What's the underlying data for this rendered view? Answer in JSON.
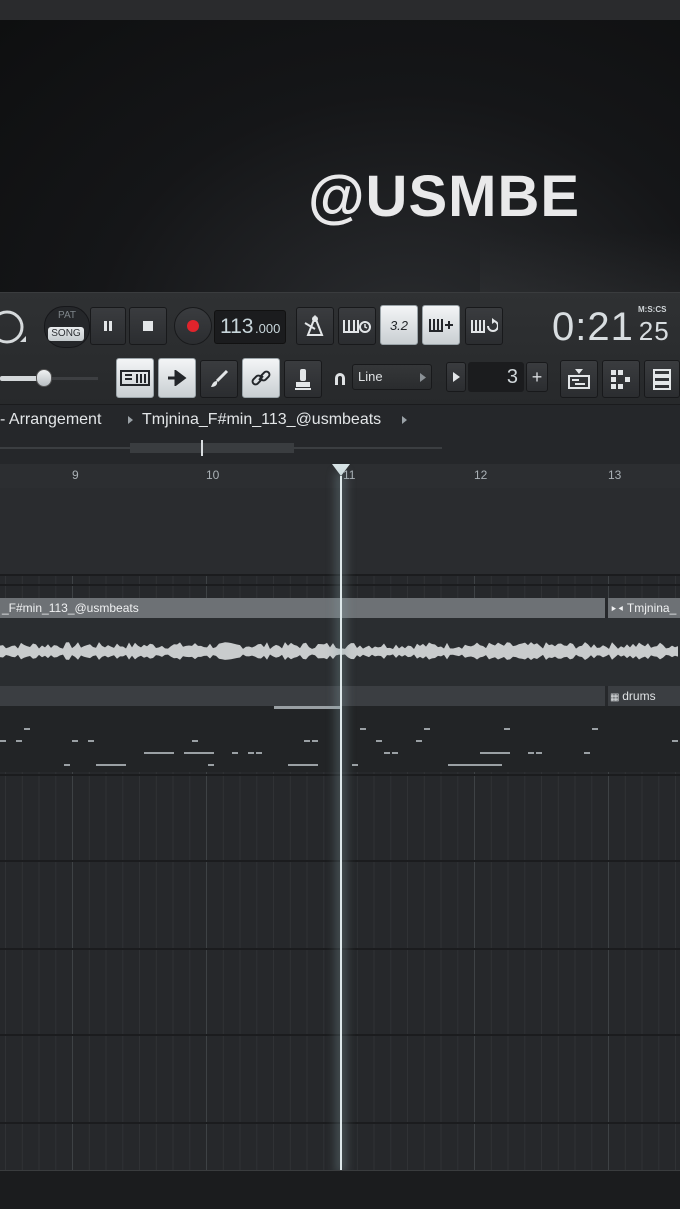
{
  "brand": {
    "text": "@USMBE"
  },
  "transport": {
    "pat_label": "PAT",
    "song_label": "SONG",
    "tempo_int": "113",
    "tempo_frac": ".000",
    "clock_main": "0:21",
    "clock_small": "25",
    "clock_label": "M:S:CS",
    "pattern_num": "3",
    "plus_label": "+",
    "snap_label": "Line",
    "toggle_32": "3.2"
  },
  "breadcrumb": {
    "part1": "- Arrangement",
    "part2": "Tmjnina_F#min_113_@usmbeats"
  },
  "ruler": {
    "bars": [
      "9",
      "10",
      "11",
      "12",
      "13"
    ]
  },
  "clips": {
    "audio_clip_left": "_F#min_113_@usmbeats",
    "audio_clip_right": "Tmjnina_",
    "pattern_clip": "drums"
  },
  "colors": {
    "accent_record": "#e0242c",
    "lit_button": "#e6eaec",
    "playhead": "#dde8ea"
  },
  "icons": [
    "knob-icon",
    "pause-icon",
    "stop-icon",
    "record-icon",
    "metronome-icon",
    "wait-icon",
    "countdown-icon",
    "step-edit-icon",
    "blend-icon",
    "loop-record-icon",
    "piano-roll-icon",
    "arrow-icon",
    "brush-icon",
    "link-icon",
    "stamp-icon",
    "magnet-icon",
    "play-small-icon",
    "plus-icon",
    "playlist-icon",
    "channel-rack-icon",
    "mixer-icon"
  ]
}
